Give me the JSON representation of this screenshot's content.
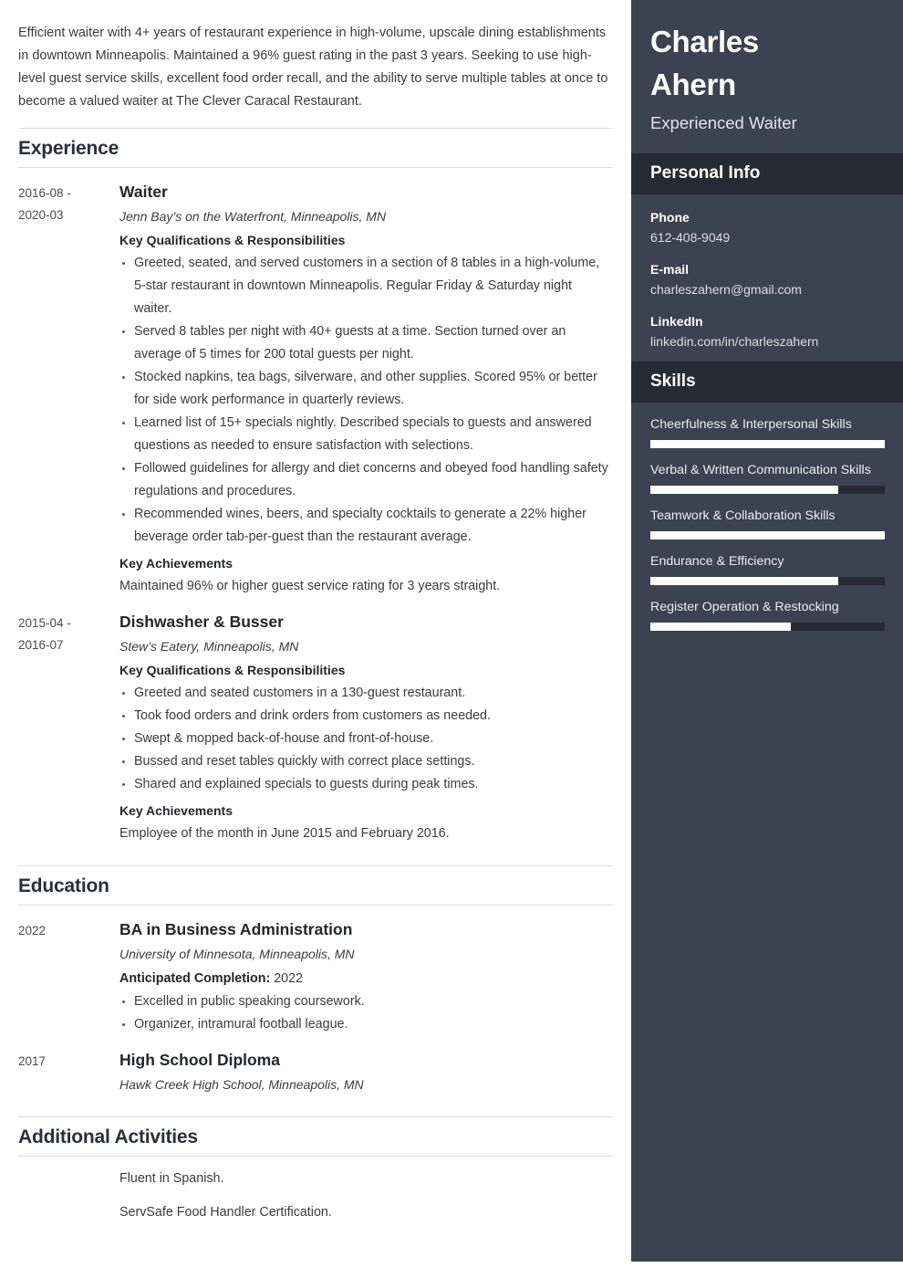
{
  "summary": "Efficient waiter with 4+ years of restaurant experience in high-volume, upscale dining establishments in downtown Minneapolis. Maintained a 96% guest rating in the past 3 years. Seeking to use high-level guest service skills, excellent food order recall, and the ability to serve multiple tables at once to become a valued waiter at The Clever Caracal Restaurant.",
  "sections": {
    "experience_title": "Experience",
    "education_title": "Education",
    "additional_title": "Additional Activities"
  },
  "labels": {
    "key_qualifications": "Key Qualifications & Responsibilities",
    "key_achievements": "Key Achievements",
    "anticipated_completion": "Anticipated Completion:"
  },
  "experience": [
    {
      "date": "2016-08 - 2020-03",
      "date_line1": "2016-08 -",
      "date_line2": "2020-03",
      "title": "Waiter",
      "company": "Jenn Bay’s on the Waterfront, Minneapolis, MN",
      "bullets": [
        "Greeted, seated, and served customers in a section of 8 tables in a high-volume, 5-star restaurant in downtown Minneapolis. Regular Friday & Saturday night waiter.",
        "Served 8 tables per night with 40+ guests at a time. Section turned over an average of 5 times for 200 total guests per night.",
        "Stocked napkins, tea bags, silverware, and other supplies. Scored 95% or better for side work performance in quarterly reviews.",
        "Learned list of 15+ specials nightly. Described specials to guests and answered questions as needed to ensure satisfaction with selections.",
        "Followed guidelines for allergy and diet concerns and obeyed food handling safety regulations and procedures.",
        "Recommended wines, beers, and specialty cocktails to generate a 22% higher beverage order tab-per-guest than the restaurant average."
      ],
      "achievement": "Maintained 96% or higher guest service rating for 3 years straight."
    },
    {
      "date": "2015-04 - 2016-07",
      "date_line1": "2015-04 -",
      "date_line2": "2016-07",
      "title": "Dishwasher & Busser",
      "company": "Stew’s Eatery, Minneapolis, MN",
      "bullets": [
        "Greeted and seated customers in a 130-guest restaurant.",
        "Took food orders and drink orders from customers as needed.",
        "Swept & mopped back-of-house and front-of-house.",
        "Bussed and reset tables quickly with correct place settings.",
        "Shared and explained specials to guests during peak times."
      ],
      "achievement": "Employee of the month in June 2015 and February 2016."
    }
  ],
  "education": [
    {
      "date": "2022",
      "title": "BA in Business Administration",
      "school": "University of Minnesota, Minneapolis, MN",
      "completion_value": "2022",
      "bullets": [
        "Excelled in public speaking coursework.",
        "Organizer, intramural football league."
      ]
    },
    {
      "date": "2017",
      "title": "High School Diploma",
      "school": "Hawk Creek High School, Minneapolis, MN",
      "completion_value": "",
      "bullets": []
    }
  ],
  "additional": [
    "Fluent in Spanish.",
    "ServSafe Food Handler Certification."
  ],
  "sidebar": {
    "name_line1": "Charles",
    "name_line2": "Ahern",
    "role": "Experienced Waiter",
    "personal_info_title": "Personal Info",
    "skills_title": "Skills",
    "contacts": [
      {
        "label": "Phone",
        "value": "612-408-9049"
      },
      {
        "label": "E-mail",
        "value": "charleszahern@gmail.com"
      },
      {
        "label": "LinkedIn",
        "value": "linkedin.com/in/charleszahern"
      }
    ],
    "skills": [
      {
        "name": "Cheerfulness & Interpersonal Skills",
        "level": 100
      },
      {
        "name": "Verbal & Written Communication Skills",
        "level": 80
      },
      {
        "name": "Teamwork & Collaboration Skills",
        "level": 100
      },
      {
        "name": "Endurance & Efficiency",
        "level": 80
      },
      {
        "name": "Register Operation & Restocking",
        "level": 60
      }
    ]
  },
  "colors": {
    "sidebar_bg": "#3b4250",
    "band_bg": "#252a34",
    "bar_fill": "#ffffff",
    "bar_track": "#252a34",
    "divider": "#dcdcdc"
  }
}
